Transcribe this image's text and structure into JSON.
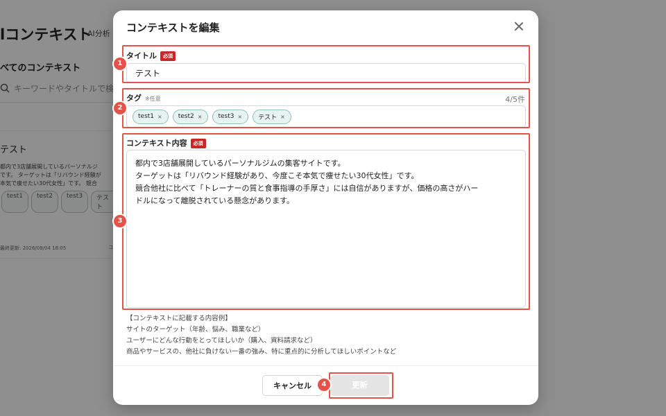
{
  "background": {
    "page_title": "lコンテキスト",
    "subtitle": "AI分析",
    "section_title": "べてのコンテキスト",
    "search_placeholder": "キーワードやタイトルで検",
    "card": {
      "title": "テスト",
      "description": "都内で3店舗展開しているパーソナルジ\nです。 ターゲットは「リバウンド経験が\n本気で痩せたい30代女性」です。 競合",
      "tags": [
        "test1",
        "test2",
        "test3",
        "テスト"
      ],
      "updated": "最終更新: 2026/08/04 18:05",
      "meta_fragment": "コ"
    }
  },
  "modal": {
    "title": "コンテキストを編集",
    "title_field": {
      "label": "タイトル",
      "required_badge": "必須",
      "value": "テスト"
    },
    "tag_field": {
      "label": "タグ",
      "optional_note": "※任意",
      "count": "4/5件",
      "tags": [
        "test1",
        "test2",
        "test3",
        "テスト"
      ],
      "remove_symbol": "×"
    },
    "content_field": {
      "label": "コンテキスト内容",
      "required_badge": "必須",
      "value": "都内で3店舗展開しているパーソナルジムの集客サイトです。\nターゲットは「リバウンド経験があり、今度こそ本気で痩せたい30代女性」です。\n競合他社に比べて「トレーナーの質と食事指導の手厚さ」には自信がありますが、価格の高さがハー\nドルになって離脱されている懸念があります。"
    },
    "hint": "【コンテキストに記載する内容例】\nサイトのターゲット（年齢、悩み、職業など）\nユーザーにどんな行動をとってほしいか（購入、資料請求など）\n商品やサービスの、他社に負けない一番の強み、特に重点的に分析してほしいポイントなど",
    "cancel_label": "キャンセル",
    "update_label": "更新"
  },
  "annotations": [
    "1",
    "2",
    "3",
    "4"
  ],
  "colors": {
    "highlight": "#e4524a",
    "required_badge": "#c62828",
    "tag_chip_bg": "#e7f3f1",
    "tag_chip_border": "#8fbfbb"
  }
}
